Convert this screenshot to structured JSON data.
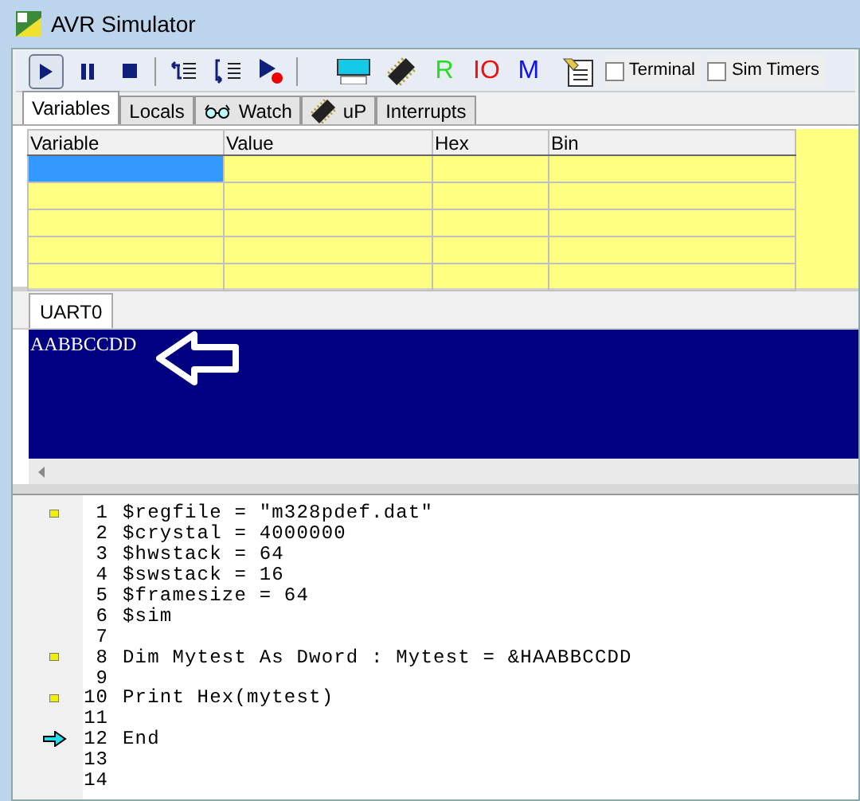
{
  "window": {
    "title": "AVR Simulator"
  },
  "toolbar": {
    "buttons": [
      {
        "kind": "play",
        "selected": true
      },
      {
        "kind": "pause",
        "selected": false
      },
      {
        "kind": "stop",
        "selected": false
      },
      {
        "kind": "step-into",
        "selected": false
      },
      {
        "kind": "step-over",
        "selected": false
      },
      {
        "kind": "run-to",
        "selected": false
      },
      {
        "kind": "lcd",
        "selected": false
      },
      {
        "kind": "chip",
        "selected": false
      },
      {
        "kind": "letter",
        "label": "R",
        "color": "#22dd22",
        "selected": false
      },
      {
        "kind": "letter",
        "label": "IO",
        "color": "#ee1111",
        "selected": false
      },
      {
        "kind": "letter",
        "label": "M",
        "color": "#1111ee",
        "selected": false
      },
      {
        "kind": "terminal",
        "selected": false
      }
    ],
    "checkboxes": [
      {
        "label": "Terminal",
        "checked": false
      },
      {
        "label": "Sim Timers",
        "checked": false
      }
    ]
  },
  "tabs": [
    {
      "label": "Variables",
      "kind": "plain",
      "selected": true
    },
    {
      "label": "Locals",
      "kind": "plain",
      "selected": false
    },
    {
      "label": "Watch",
      "kind": "glasses",
      "selected": false
    },
    {
      "label": "uP",
      "kind": "chip",
      "selected": false
    },
    {
      "label": "Interrupts",
      "kind": "plain",
      "selected": false
    }
  ],
  "table": {
    "columns": [
      "Variable",
      "Value",
      "Hex",
      "Bin"
    ],
    "rows": [
      {
        "selected": true
      },
      {
        "selected": false
      },
      {
        "selected": false
      },
      {
        "selected": false
      },
      {
        "selected": false
      }
    ]
  },
  "uart": {
    "tab": "UART0",
    "output": "AABBCCDD"
  },
  "code": {
    "lines": [
      {
        "number": "1",
        "text": "$regfile = \"m328pdef.dat\"",
        "kind": "breakpoint"
      },
      {
        "number": "2",
        "text": "$crystal = 4000000",
        "kind": "none"
      },
      {
        "number": "3",
        "text": "$hwstack = 64",
        "kind": "none"
      },
      {
        "number": "4",
        "text": "$swstack = 16",
        "kind": "none"
      },
      {
        "number": "5",
        "text": "$framesize = 64",
        "kind": "none"
      },
      {
        "number": "6",
        "text": "$sim",
        "kind": "none"
      },
      {
        "number": "7",
        "kind": "none"
      },
      {
        "number": "8",
        "text": "Dim Mytest As Dword : Mytest = &HAABBCCDD",
        "kind": "breakpoint"
      },
      {
        "number": "9",
        "kind": "none"
      },
      {
        "number": "10",
        "text": "Print Hex(mytest)",
        "kind": "breakpoint"
      },
      {
        "number": "11",
        "kind": "none"
      },
      {
        "number": "12",
        "text": "End",
        "kind": "current"
      },
      {
        "number": "13",
        "kind": "none"
      },
      {
        "number": "14",
        "kind": "none"
      }
    ]
  }
}
